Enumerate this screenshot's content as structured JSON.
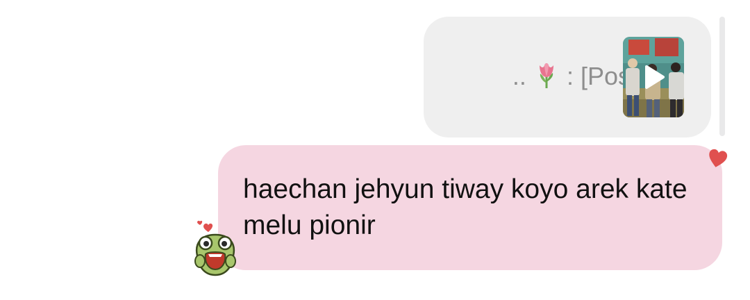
{
  "reply_preview": {
    "prefix": "..",
    "tulip_icon": "tulip-emoji",
    "text": ": [Post]",
    "thumbnail_icon": "video-thumbnail",
    "play_icon": "play-icon"
  },
  "message": {
    "text": "haechan jehyun tiway koyo arek kate melu pionir",
    "reaction_icon": "red-heart-icon",
    "sticker_icon": "frog-sticker-icon"
  },
  "colors": {
    "message_bubble": "#f5d6e1",
    "quoted_bubble": "#efefef",
    "quoted_text": "#8e8e8e",
    "heart": "#e0504f"
  }
}
